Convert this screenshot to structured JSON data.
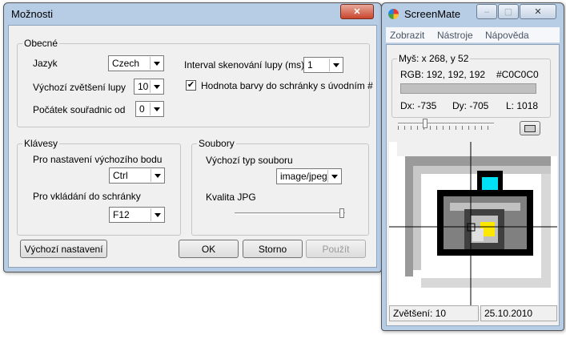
{
  "options_window": {
    "title": "Možnosti",
    "general": {
      "legend": "Obecné",
      "language_label": "Jazyk",
      "language_value": "Czech",
      "zoom_label": "Výchozí zvětšení lupy",
      "zoom_value": "10",
      "origin_label": "Počátek souřadnic od",
      "origin_value": "0",
      "interval_label": "Interval skenování lupy (ms)",
      "interval_value": "1",
      "hash_label": "Hodnota barvy do schránky s úvodním #",
      "hash_checked": "✔"
    },
    "keys": {
      "legend": "Klávesy",
      "default_point_label": "Pro nastavení výchozího bodu",
      "default_point_value": "Ctrl",
      "clipboard_label": "Pro vkládání do schránky",
      "clipboard_value": "F12"
    },
    "files": {
      "legend": "Soubory",
      "type_label": "Výchozí typ souboru",
      "type_value": "image/jpeg",
      "quality_label": "Kvalita JPG",
      "quality_level": 0.97
    },
    "buttons": {
      "defaults": "Výchozí nastavení",
      "ok": "OK",
      "cancel": "Storno",
      "apply": "Použít"
    }
  },
  "screenmate": {
    "title": "ScreenMate",
    "menu": [
      "Zobrazit",
      "Nástroje",
      "Nápověda"
    ],
    "info": {
      "mouse": "Myš: x 268, y 52",
      "rgb": "RGB: 192, 192, 192",
      "hex": "#C0C0C0",
      "dx": "Dx: -735",
      "dy": "Dy: -705",
      "l": "L: 1018",
      "swatch_color": "#C0C0C0"
    },
    "zoom_slider_level": 0.28,
    "status": {
      "zoom": "Zvětšení: 10",
      "date": "25.10.2010"
    }
  }
}
